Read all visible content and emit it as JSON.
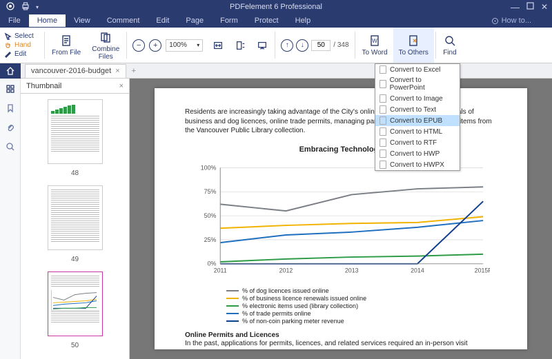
{
  "app": {
    "title": "PDFelement 6 Professional"
  },
  "menus": [
    "File",
    "Home",
    "View",
    "Comment",
    "Edit",
    "Page",
    "Form",
    "Protect",
    "Help"
  ],
  "menu_active": 1,
  "howto": "How to...",
  "ribbon": {
    "select": "Select",
    "hand": "Hand",
    "edit": "Edit",
    "from_file": "From File",
    "combine_files": "Combine\nFiles",
    "zoom_pct": "100%",
    "page_current": "50",
    "page_total": "/  348",
    "to_word": "To Word",
    "to_others": "To Others",
    "find": "Find"
  },
  "tab": {
    "name": "vancouver-2016-budget"
  },
  "thumb_panel": {
    "title": "Thumbnail"
  },
  "thumbs": [
    {
      "label": "48"
    },
    {
      "label": "49"
    },
    {
      "label": "50",
      "selected": true
    }
  ],
  "doc": {
    "para1": "Residents are increasingly taking advantage of the City's online services, including renewals of business and dog licences, online trade permits, managing parking meters and borrowing items from the Vancouver Public Library collection.",
    "sec2_title": "Online Permits and Licences",
    "sec2_text": "In the past, applications for permits, licences, and related services required an in-person visit"
  },
  "chart_data": {
    "type": "line",
    "title": "Embracing Technology",
    "xlabel": "",
    "ylabel": "",
    "ylim": [
      0,
      100
    ],
    "yticks": [
      "0%",
      "25%",
      "50%",
      "75%",
      "100%"
    ],
    "categories": [
      "2011",
      "2012",
      "2013",
      "2014",
      "2015F"
    ],
    "series": [
      {
        "name": "% of dog licences issued online",
        "color": "#7a7f85",
        "values": [
          62,
          55,
          72,
          78,
          80
        ]
      },
      {
        "name": "% of business licence renewals issued online",
        "color": "#f2b200",
        "values": [
          37,
          40,
          42,
          43,
          49
        ]
      },
      {
        "name": "% electronic items used (library collection)",
        "color": "#2e9b47",
        "values": [
          2,
          5,
          7,
          8,
          10
        ]
      },
      {
        "name": "% of trade permits online",
        "color": "#1e6fbf",
        "values": [
          22,
          30,
          33,
          38,
          45
        ]
      },
      {
        "name": "% of non-coin parking meter revenue",
        "color": "#0f3f8f",
        "values": [
          0,
          0,
          0,
          0,
          65
        ]
      }
    ]
  },
  "dropdown": {
    "items": [
      "Convert to Excel",
      "Convert to PowerPoint",
      "Convert to Image",
      "Convert to Text",
      "Convert to EPUB",
      "Convert to HTML",
      "Convert to RTF",
      "Convert to HWP",
      "Convert to HWPX"
    ],
    "hover_index": 4
  }
}
